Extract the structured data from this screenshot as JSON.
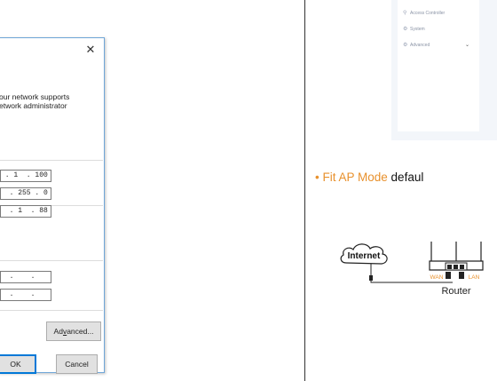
{
  "dialog": {
    "description_lines": [
      "our network supports",
      "etwork administrator"
    ],
    "ip_fields": [
      " . 1  . 100",
      "  . 255 . 0",
      "  . 1  . 88"
    ],
    "dns_fields": [
      "  .    .",
      "  .    ."
    ],
    "advanced_pre": "Ad",
    "advanced_u": "v",
    "advanced_post": "anced...",
    "ok_label": "OK",
    "cancel_label": "Cancel"
  },
  "sidebar": {
    "items": [
      {
        "label": "Access Controller",
        "icon": "location-pin-icon"
      },
      {
        "label": "System",
        "icon": "gear-icon"
      },
      {
        "label": "Advanced",
        "icon": "advanced-gears-icon"
      }
    ]
  },
  "bullet": {
    "highlight": "Fit AP Mode",
    "rest": " defaul"
  },
  "diagram": {
    "internet_label": "Internet",
    "wan_label": "WAN",
    "lan_label": "LAN",
    "router_label": "Router"
  },
  "colors": {
    "accent_orange": "#e8912d",
    "dialog_border": "#6fa6d8",
    "ok_border": "#0078d7"
  }
}
